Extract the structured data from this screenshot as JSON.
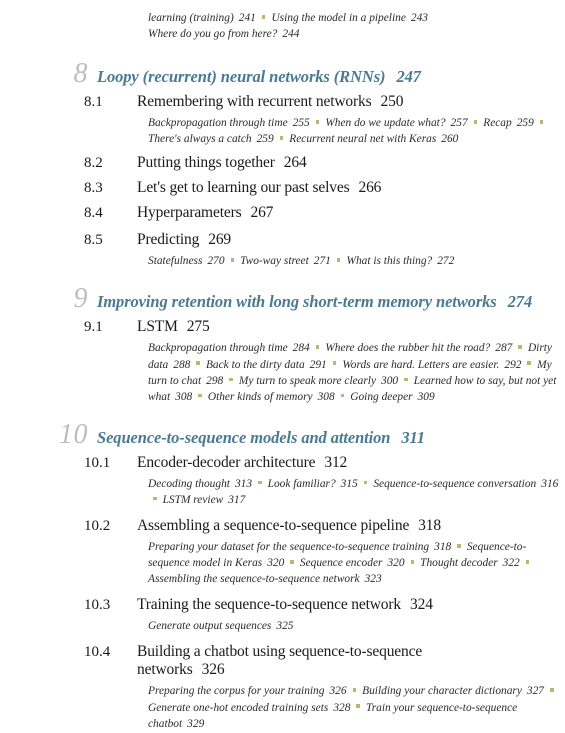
{
  "document": {
    "kind": "book-table-of-contents",
    "colors": {
      "chapter_number": "#bdbdbd",
      "chapter_title": "#4a7a92",
      "body_text": "#1a1a1a",
      "separator_square": "#c3b273",
      "page_background": "#ffffff"
    }
  },
  "top_continuation": {
    "line1": "learning (training)",
    "line1_page": "241",
    "line2": "Using the model in a pipeline",
    "line2_page": "243",
    "line3": "Where do you go from here?",
    "line3_page": "244"
  },
  "chapters": [
    {
      "number": "8",
      "title": "Loopy (recurrent) neural networks (RNNs)",
      "page": "247",
      "sections": [
        {
          "number": "8.1",
          "title": "Remembering with recurrent networks",
          "page": "250",
          "subentries": [
            {
              "title": "Backpropagation through time",
              "page": "255"
            },
            {
              "title": "When do we update what?",
              "page": "257"
            },
            {
              "title": "Recap",
              "page": "259"
            },
            {
              "title": "There's always a catch",
              "page": "259"
            },
            {
              "title": "Recurrent neural net with Keras",
              "page": "260"
            }
          ]
        },
        {
          "number": "8.2",
          "title": "Putting things together",
          "page": "264",
          "subentries": []
        },
        {
          "number": "8.3",
          "title": "Let's get to learning our past selves",
          "page": "266",
          "subentries": []
        },
        {
          "number": "8.4",
          "title": "Hyperparameters",
          "page": "267",
          "subentries": []
        },
        {
          "number": "8.5",
          "title": "Predicting",
          "page": "269",
          "subentries": [
            {
              "title": "Statefulness",
              "page": "270"
            },
            {
              "title": "Two-way street",
              "page": "271"
            },
            {
              "title": "What is this thing?",
              "page": "272"
            }
          ]
        }
      ]
    },
    {
      "number": "9",
      "title": "Improving retention with long short-term memory networks",
      "page": "274",
      "sections": [
        {
          "number": "9.1",
          "title": "LSTM",
          "page": "275",
          "subentries": [
            {
              "title": "Backpropagation through time",
              "page": "284"
            },
            {
              "title": "Where does the rubber hit the road?",
              "page": "287"
            },
            {
              "title": "Dirty data",
              "page": "288"
            },
            {
              "title": "Back to the dirty data",
              "page": "291"
            },
            {
              "title": "Words are hard. Letters are easier.",
              "page": "292"
            },
            {
              "title": "My turn to chat",
              "page": "298"
            },
            {
              "title": "My turn to speak more clearly",
              "page": "300"
            },
            {
              "title": "Learned how to say, but not yet what",
              "page": "308"
            },
            {
              "title": "Other kinds of memory",
              "page": "308"
            },
            {
              "title": "Going deeper",
              "page": "309"
            }
          ]
        }
      ]
    },
    {
      "number": "10",
      "title": "Sequence-to-sequence models and attention",
      "page": "311",
      "sections": [
        {
          "number": "10.1",
          "title": "Encoder-decoder architecture",
          "page": "312",
          "subentries": [
            {
              "title": "Decoding thought",
              "page": "313"
            },
            {
              "title": "Look familiar?",
              "page": "315"
            },
            {
              "title": "Sequence-to-sequence conversation",
              "page": "316"
            },
            {
              "title": "LSTM review",
              "page": "317"
            }
          ]
        },
        {
          "number": "10.2",
          "title": "Assembling a sequence-to-sequence pipeline",
          "page": "318",
          "subentries": [
            {
              "title": "Preparing your dataset for the sequence-to-sequence training",
              "page": "318"
            },
            {
              "title": "Sequence-to-sequence model in Keras",
              "page": "320"
            },
            {
              "title": "Sequence encoder",
              "page": "320"
            },
            {
              "title": "Thought decoder",
              "page": "322"
            },
            {
              "title": "Assembling the sequence-to-sequence network",
              "page": "323"
            }
          ]
        },
        {
          "number": "10.3",
          "title": "Training the sequence-to-sequence network",
          "page": "324",
          "subentries": [
            {
              "title": "Generate output sequences",
              "page": "325"
            }
          ]
        },
        {
          "number": "10.4",
          "title": "Building a chatbot using sequence-to-sequence networks",
          "page": "326",
          "subentries": [
            {
              "title": "Preparing the corpus for your training",
              "page": "326"
            },
            {
              "title": "Building your character dictionary",
              "page": "327"
            },
            {
              "title": "Generate one-hot encoded training sets",
              "page": "328"
            },
            {
              "title": "Train your sequence-to-sequence chatbot",
              "page": "329"
            }
          ]
        }
      ]
    }
  ]
}
